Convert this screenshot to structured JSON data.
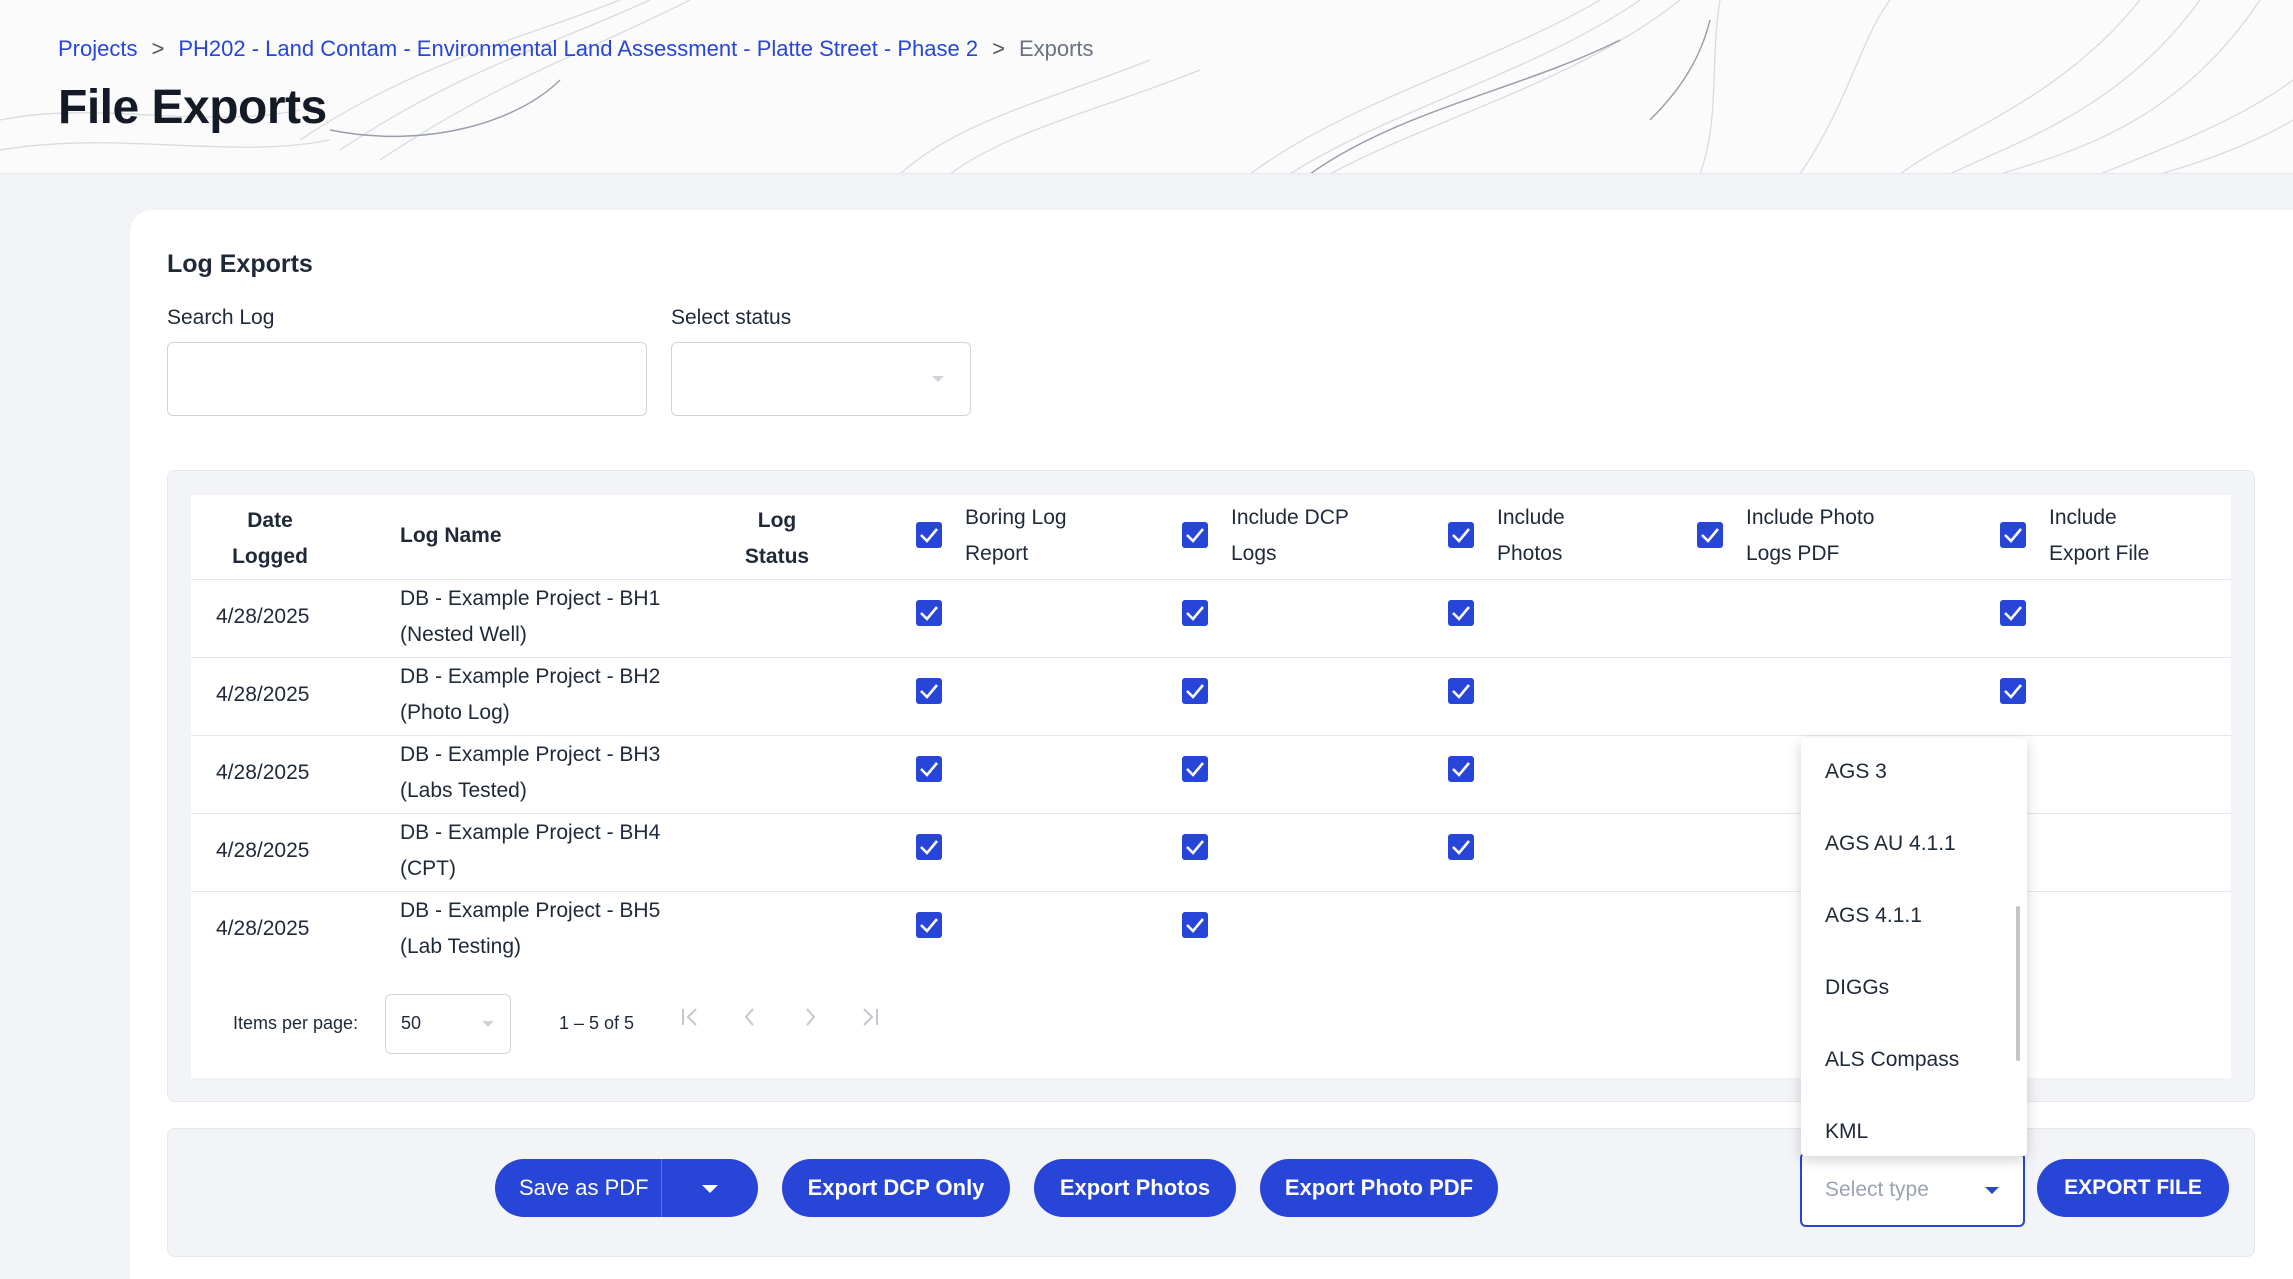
{
  "breadcrumb": {
    "projects": "Projects",
    "project": "PH202 - Land Contam - Environmental Land Assessment - Platte Street - Phase 2",
    "current": "Exports",
    "sep": ">"
  },
  "page_title": "File Exports",
  "log_exports": {
    "title": "Log Exports",
    "search_label": "Search Log",
    "search_value": "",
    "status_label": "Select status",
    "status_value": ""
  },
  "table": {
    "headers": {
      "date": [
        "Date",
        "Logged"
      ],
      "name": "Log Name",
      "status": [
        "Log",
        "Status"
      ],
      "boring": [
        "Boring Log",
        "Report"
      ],
      "dcp": [
        "Include DCP",
        "Logs"
      ],
      "photos": [
        "Include",
        "Photos"
      ],
      "photo_pdf": [
        "Include Photo",
        "Logs PDF"
      ],
      "export_file": [
        "Include",
        "Export File"
      ]
    },
    "header_checks": {
      "boring": true,
      "dcp": true,
      "photos": true,
      "photo_pdf": true,
      "export_file": true
    },
    "rows": [
      {
        "date": "4/28/2025",
        "name": [
          "DB - Example Project - BH1",
          "(Nested Well)"
        ],
        "status": "",
        "boring": true,
        "dcp": true,
        "photos": true,
        "photo_pdf": false,
        "export_file": true
      },
      {
        "date": "4/28/2025",
        "name": [
          "DB - Example Project - BH2",
          "(Photo Log)"
        ],
        "status": "",
        "boring": true,
        "dcp": true,
        "photos": true,
        "photo_pdf": false,
        "export_file": true
      },
      {
        "date": "4/28/2025",
        "name": [
          "DB - Example Project - BH3",
          "(Labs Tested)"
        ],
        "status": "",
        "boring": true,
        "dcp": true,
        "photos": true,
        "photo_pdf": false,
        "export_file": false
      },
      {
        "date": "4/28/2025",
        "name": [
          "DB - Example Project - BH4",
          "(CPT)"
        ],
        "status": "",
        "boring": true,
        "dcp": true,
        "photos": true,
        "photo_pdf": false,
        "export_file": false
      },
      {
        "date": "4/28/2025",
        "name": [
          "DB - Example Project - BH5",
          "(Lab Testing)"
        ],
        "status": "",
        "boring": true,
        "dcp": true,
        "photos": false,
        "photo_pdf": false,
        "export_file": false
      }
    ]
  },
  "pager": {
    "items_per_page_label": "Items per page:",
    "items_per_page": "50",
    "range": "1 – 5 of 5"
  },
  "actions": {
    "save_pdf": "Save as PDF",
    "export_dcp": "Export DCP Only",
    "export_photos": "Export Photos",
    "export_photo_pdf": "Export Photo PDF",
    "select_type_placeholder": "Select type",
    "export_file": "EXPORT FILE"
  },
  "type_options": [
    "AGS 3",
    "AGS AU 4.1.1",
    "AGS 4.1.1",
    "DIGGs",
    "ALS Compass",
    "KML"
  ],
  "colors": {
    "accent": "#2745d6",
    "title": "#141a26"
  }
}
